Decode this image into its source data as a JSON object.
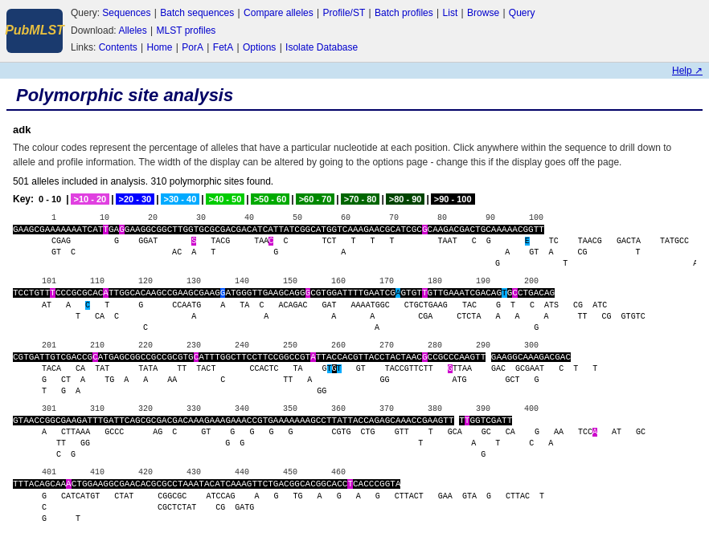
{
  "header": {
    "logo_text": "PubMLST",
    "query_label": "Query:",
    "download_label": "Download:",
    "links_label": "Links:",
    "nav_query": [
      {
        "label": "Sequences",
        "url": "#"
      },
      {
        "label": "Batch sequences",
        "url": "#"
      },
      {
        "label": "Compare alleles",
        "url": "#"
      },
      {
        "label": "Profile/ST",
        "url": "#"
      },
      {
        "label": "Batch profiles",
        "url": "#"
      },
      {
        "label": "List",
        "url": "#"
      },
      {
        "label": "Browse",
        "url": "#"
      },
      {
        "label": "Query",
        "url": "#"
      }
    ],
    "nav_download": [
      {
        "label": "Alleles",
        "url": "#"
      },
      {
        "label": "MLST profiles",
        "url": "#"
      }
    ],
    "nav_links": [
      {
        "label": "Contents",
        "url": "#"
      },
      {
        "label": "Home",
        "url": "#"
      },
      {
        "label": "PorA",
        "url": "#"
      },
      {
        "label": "FetA",
        "url": "#"
      },
      {
        "label": "Options",
        "url": "#"
      },
      {
        "label": "Isolate Database",
        "url": "#"
      }
    ]
  },
  "help": {
    "label": "Help ↗"
  },
  "page": {
    "title": "Polymorphic site analysis",
    "gene": "adk",
    "description": "The colour codes represent the percentage of alleles that have a particular nucleotide at each position. Click anywhere within the sequence to drill down to allele and profile information. The width of the display can be altered by going to the options page - change this if the display goes off the page.",
    "stats": "501 alleles included in analysis. 310 polymorphic sites found."
  },
  "key": {
    "label": "Key:",
    "items": [
      {
        "range": "0 - 10",
        "class": "k0"
      },
      {
        "range": ">10 - 20",
        "class": "k10"
      },
      {
        "range": ">20 - 30",
        "class": "k20"
      },
      {
        "range": ">30 - 40",
        "class": "k30"
      },
      {
        "range": ">40 - 50",
        "class": "k40"
      },
      {
        "range": ">50 - 60",
        "class": "k50"
      },
      {
        "range": ">60 - 70",
        "class": "k60"
      },
      {
        "range": ">70 - 80",
        "class": "k70"
      },
      {
        "range": ">80 - 90",
        "class": "k80"
      },
      {
        "range": ">90 - 100",
        "class": "k90"
      }
    ]
  }
}
